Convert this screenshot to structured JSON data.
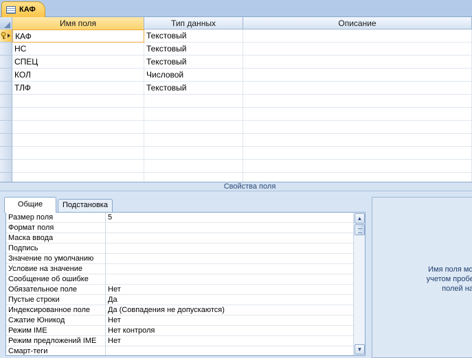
{
  "document_tab": {
    "title": "КАФ"
  },
  "grid": {
    "columns": {
      "name": "Имя поля",
      "type": "Тип данных",
      "description": "Описание"
    },
    "rows": [
      {
        "name": "КАФ",
        "type": "Текстовый",
        "description": "",
        "primary_key": true
      },
      {
        "name": "НС",
        "type": "Текстовый",
        "description": ""
      },
      {
        "name": "СПЕЦ",
        "type": "Текстовый",
        "description": ""
      },
      {
        "name": "КОЛ",
        "type": "Числовой",
        "description": ""
      },
      {
        "name": "ТЛФ",
        "type": "Текстовый",
        "description": ""
      },
      {
        "name": "",
        "type": "",
        "description": ""
      },
      {
        "name": "",
        "type": "",
        "description": ""
      },
      {
        "name": "",
        "type": "",
        "description": ""
      },
      {
        "name": "",
        "type": "",
        "description": ""
      },
      {
        "name": "",
        "type": "",
        "description": ""
      },
      {
        "name": "",
        "type": "",
        "description": ""
      },
      {
        "name": "",
        "type": "",
        "description": ""
      }
    ]
  },
  "properties_bar": {
    "label": "Свойства поля"
  },
  "property_tabs": {
    "general": "Общие",
    "lookup": "Подстановка"
  },
  "properties": [
    {
      "label": "Размер поля",
      "value": "5"
    },
    {
      "label": "Формат поля",
      "value": ""
    },
    {
      "label": "Маска ввода",
      "value": ""
    },
    {
      "label": "Подпись",
      "value": ""
    },
    {
      "label": "Значение по умолчанию",
      "value": ""
    },
    {
      "label": "Условие на значение",
      "value": ""
    },
    {
      "label": "Сообщение об ошибке",
      "value": ""
    },
    {
      "label": "Обязательное поле",
      "value": "Нет"
    },
    {
      "label": "Пустые строки",
      "value": "Да"
    },
    {
      "label": "Индексированное поле",
      "value": "Да (Совпадения не допускаются)"
    },
    {
      "label": "Сжатие Юникод",
      "value": "Нет"
    },
    {
      "label": "Режим IME",
      "value": "Нет контроля"
    },
    {
      "label": "Режим предложений IME",
      "value": "Нет"
    },
    {
      "label": "Смарт-теги",
      "value": ""
    }
  ],
  "help": {
    "text": "Имя поля может состоят\nучетом пробелов.  Для сп\nполей нажмите к"
  },
  "colors": {
    "tab_active": "#fbc54a",
    "header_active": "#fbd36e",
    "chrome": "#bfd3ea"
  }
}
